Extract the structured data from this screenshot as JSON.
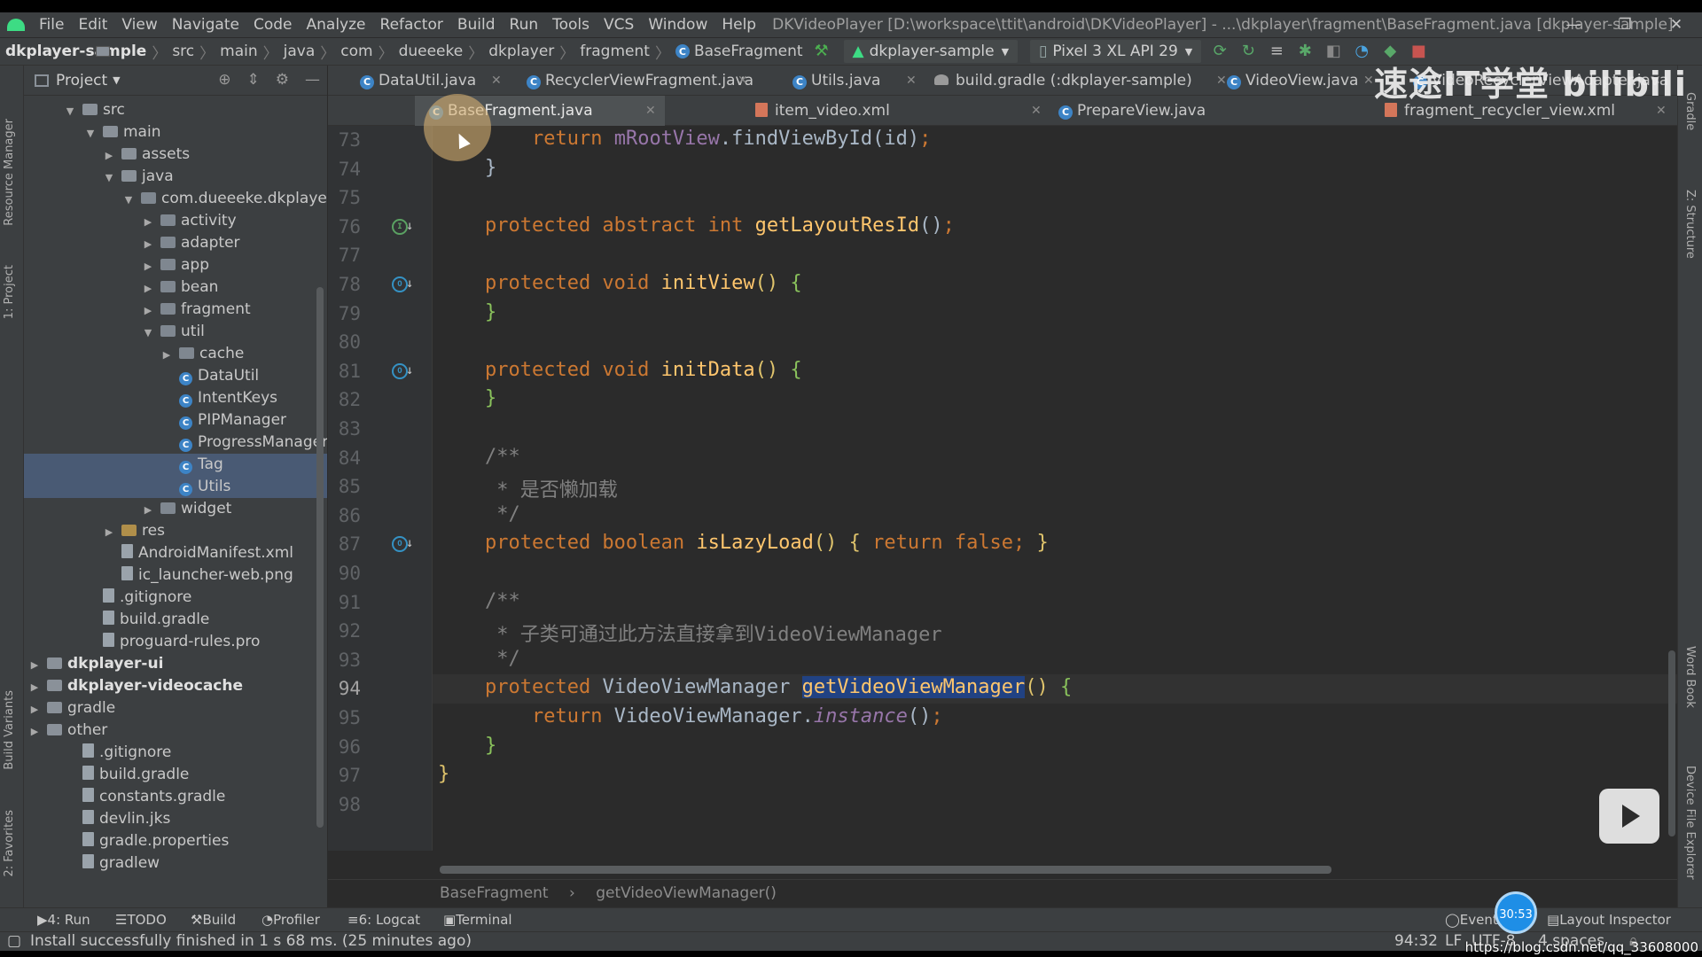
{
  "window": {
    "title": "DKVideoPlayer [D:\\workspace\\ttit\\android\\DKVideoPlayer] - ...\\dkplayer\\fragment\\BaseFragment.java [dkplayer-sample]",
    "controls": [
      "—",
      "❐",
      "✕"
    ]
  },
  "menu": [
    "File",
    "Edit",
    "View",
    "Navigate",
    "Code",
    "Analyze",
    "Refactor",
    "Build",
    "Run",
    "Tools",
    "VCS",
    "Window",
    "Help"
  ],
  "navbar": {
    "crumbs": [
      "dkplayer-sample",
      "src",
      "main",
      "java",
      "com",
      "dueeeke",
      "dkplayer",
      "fragment",
      "BaseFragment"
    ],
    "run_config": "dkplayer-sample",
    "device": "Pixel 3 XL API 29"
  },
  "left_strip": [
    "Resource Manager",
    "1: Project",
    "Build Variants",
    "2: Favorites"
  ],
  "right_strip": [
    "Gradle",
    "Z: Structure",
    "Word Book",
    "Device File Explorer"
  ],
  "project_panel": {
    "title": "Project",
    "tree": [
      {
        "label": "src",
        "depth": 1,
        "open": true,
        "kind": "folder"
      },
      {
        "label": "main",
        "depth": 2,
        "open": true,
        "kind": "folder"
      },
      {
        "label": "assets",
        "depth": 3,
        "open": false,
        "kind": "folder"
      },
      {
        "label": "java",
        "depth": 3,
        "open": true,
        "kind": "folder"
      },
      {
        "label": "com.dueeeke.dkplayer",
        "depth": 4,
        "open": true,
        "kind": "pkg"
      },
      {
        "label": "activity",
        "depth": 5,
        "open": false,
        "kind": "pkg"
      },
      {
        "label": "adapter",
        "depth": 5,
        "open": false,
        "kind": "pkg"
      },
      {
        "label": "app",
        "depth": 5,
        "open": false,
        "kind": "pkg"
      },
      {
        "label": "bean",
        "depth": 5,
        "open": false,
        "kind": "pkg"
      },
      {
        "label": "fragment",
        "depth": 5,
        "open": false,
        "kind": "pkg"
      },
      {
        "label": "util",
        "depth": 5,
        "open": true,
        "kind": "pkg"
      },
      {
        "label": "cache",
        "depth": 6,
        "open": false,
        "kind": "pkg"
      },
      {
        "label": "DataUtil",
        "depth": 6,
        "kind": "class"
      },
      {
        "label": "IntentKeys",
        "depth": 6,
        "kind": "class"
      },
      {
        "label": "PIPManager",
        "depth": 6,
        "kind": "class"
      },
      {
        "label": "ProgressManagerIm",
        "depth": 6,
        "kind": "class"
      },
      {
        "label": "Tag",
        "depth": 6,
        "kind": "class",
        "selected": true
      },
      {
        "label": "Utils",
        "depth": 6,
        "kind": "class",
        "selected": true
      },
      {
        "label": "widget",
        "depth": 5,
        "open": false,
        "kind": "pkg"
      },
      {
        "label": "res",
        "depth": 3,
        "open": false,
        "kind": "res"
      },
      {
        "label": "AndroidManifest.xml",
        "depth": 3,
        "kind": "file"
      },
      {
        "label": "ic_launcher-web.png",
        "depth": 3,
        "kind": "file"
      },
      {
        "label": ".gitignore",
        "depth": 2,
        "kind": "file"
      },
      {
        "label": "build.gradle",
        "depth": 2,
        "kind": "file"
      },
      {
        "label": "proguard-rules.pro",
        "depth": 2,
        "kind": "file"
      },
      {
        "label": "dkplayer-ui",
        "depth": 0,
        "open": false,
        "kind": "folder",
        "bold": true
      },
      {
        "label": "dkplayer-videocache",
        "depth": 0,
        "open": false,
        "kind": "folder",
        "bold": true
      },
      {
        "label": "gradle",
        "depth": 0,
        "open": false,
        "kind": "folder"
      },
      {
        "label": "other",
        "depth": 0,
        "open": false,
        "kind": "folder"
      },
      {
        "label": ".gitignore",
        "depth": 1,
        "kind": "file"
      },
      {
        "label": "build.gradle",
        "depth": 1,
        "kind": "file"
      },
      {
        "label": "constants.gradle",
        "depth": 1,
        "kind": "file"
      },
      {
        "label": "devlin.jks",
        "depth": 1,
        "kind": "file"
      },
      {
        "label": "gradle.properties",
        "depth": 1,
        "kind": "file"
      },
      {
        "label": "gradlew",
        "depth": 1,
        "kind": "file"
      }
    ]
  },
  "tabs_row1": [
    {
      "label": "DataUtil.java",
      "icon": "class"
    },
    {
      "label": "RecyclerViewFragment.java",
      "icon": "class"
    },
    {
      "label": "Utils.java",
      "icon": "class"
    },
    {
      "label": "build.gradle (:dkplayer-sample)",
      "icon": "gradle"
    },
    {
      "label": "VideoView.java",
      "icon": "class"
    },
    {
      "label": "VideoRecyclerViewAdapter.java",
      "icon": "class"
    }
  ],
  "tabs_row2": [
    {
      "label": "BaseFragment.java",
      "icon": "class",
      "active": true
    },
    {
      "label": "item_video.xml",
      "icon": "xml"
    },
    {
      "label": "PrepareView.java",
      "icon": "class"
    },
    {
      "label": "fragment_recycler_view.xml",
      "icon": "xml"
    }
  ],
  "code": {
    "current_line": "94",
    "lines": [
      {
        "n": "73",
        "html": "        <span class=\"kw\">return</span> <span class=\"fld\">mRootView</span>.findViewById(id)<span class=\"kw\">;</span>"
      },
      {
        "n": "74",
        "html": "    }"
      },
      {
        "n": "75",
        "html": ""
      },
      {
        "n": "76",
        "html": "    <span class=\"kw\">protected abstract int</span> <span class=\"fn\">getLayoutResId</span>()<span class=\"kw\">;</span>",
        "mark": "I",
        "mclass": "g"
      },
      {
        "n": "77",
        "html": ""
      },
      {
        "n": "78",
        "html": "    <span class=\"kw\">protected void</span> <span class=\"fn\">initView</span><span class=\"pa\">()</span> <span class=\"pb\">{</span>",
        "mark": "O"
      },
      {
        "n": "79",
        "html": "    <span class=\"pb\">}</span>"
      },
      {
        "n": "80",
        "html": ""
      },
      {
        "n": "81",
        "html": "    <span class=\"kw\">protected void</span> <span class=\"fn\">initData</span><span class=\"pa\">()</span> <span class=\"pb\">{</span>",
        "mark": "O"
      },
      {
        "n": "82",
        "html": "    <span class=\"pb\">}</span>"
      },
      {
        "n": "83",
        "html": ""
      },
      {
        "n": "84",
        "html": "    <span class=\"cm\">/**</span>"
      },
      {
        "n": "85",
        "html": "<span class=\"cm\">     * 是否懒加载</span>"
      },
      {
        "n": "86",
        "html": "<span class=\"cm\">     */</span>"
      },
      {
        "n": "87",
        "html": "    <span class=\"kw\">protected boolean</span> <span class=\"fn\">isLazyLoad</span><span class=\"pa\">()</span> <span class=\"pa\">{</span> <span class=\"kw\">return false;</span> <span class=\"pa\">}</span>",
        "mark": "O"
      },
      {
        "n": "90",
        "html": ""
      },
      {
        "n": "91",
        "html": "    <span class=\"cm\">/**</span>"
      },
      {
        "n": "92",
        "html": "<span class=\"cm\">     * 子类可通过此方法直接拿到VideoViewManager</span>"
      },
      {
        "n": "93",
        "html": "<span class=\"cm\">     */</span>"
      },
      {
        "n": "94",
        "html": "    <span class=\"kw\">protected</span> VideoViewManager <span class=\"bhl\">getVideoViewManager</span><span class=\"pa\">()</span> <span class=\"pb\">{</span>"
      },
      {
        "n": "95",
        "html": "        <span class=\"kw\">return</span> VideoViewManager.<span class=\"st\">instance</span>()<span class=\"kw\">;</span>"
      },
      {
        "n": "96",
        "html": "    <span class=\"pb\">}</span>"
      },
      {
        "n": "97",
        "html": "<span class=\"pa\">}</span>"
      },
      {
        "n": "98",
        "html": ""
      }
    ]
  },
  "editor_breadcrumbs": [
    "BaseFragment",
    "getVideoViewManager()"
  ],
  "toolwindows": [
    "4: Run",
    "TODO",
    "Build",
    "Profiler",
    "6: Logcat",
    "Terminal"
  ],
  "toolwindows_right": [
    "Event Log",
    "Layout Inspector"
  ],
  "status": {
    "message": "Install successfully finished in 1 s 68 ms. (25 minutes ago)",
    "position": "94:32",
    "line_sep": "LF",
    "encoding": "UTF-8",
    "indent": "4 spaces"
  },
  "overlays": {
    "watermark": "速途IT学堂  bilibili",
    "timer": "30:53",
    "url": "https://blog.csdn.net/qq_33608000"
  }
}
